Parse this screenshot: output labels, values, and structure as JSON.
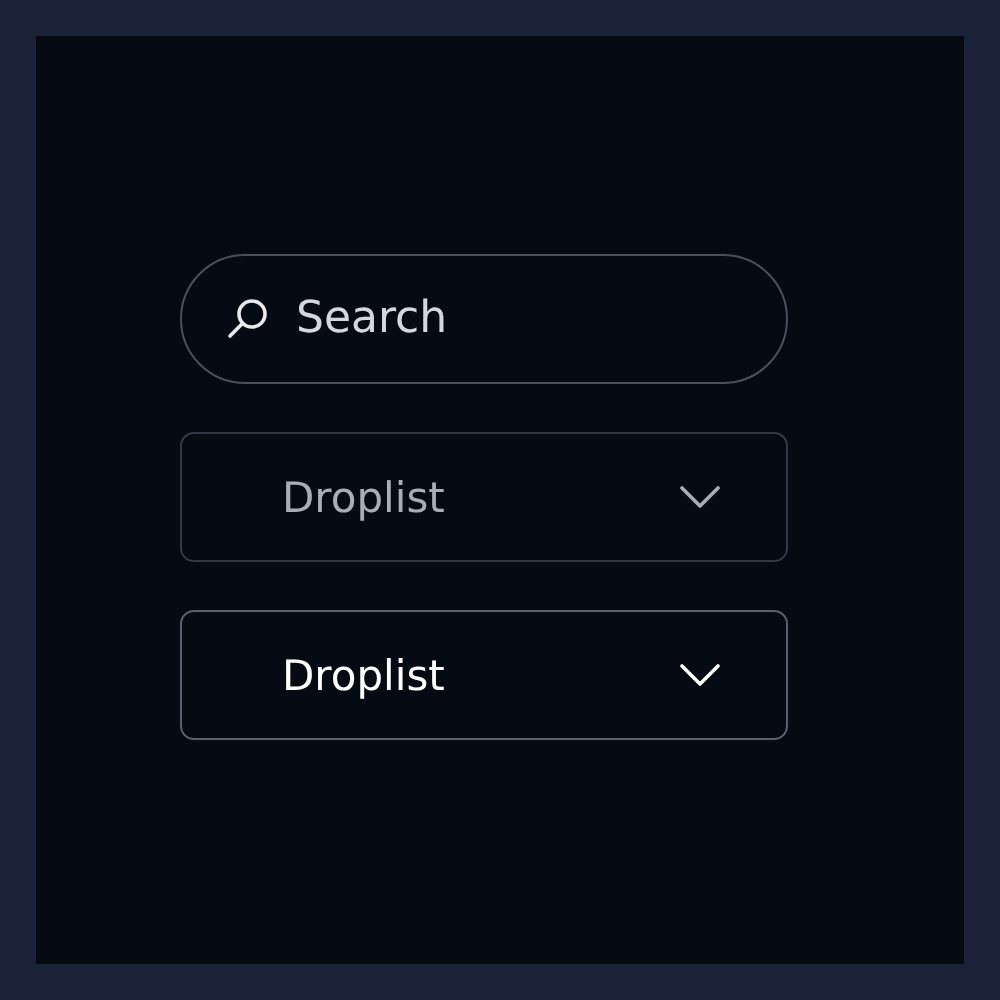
{
  "search": {
    "placeholder": "Search"
  },
  "droplists": [
    {
      "label": "Droplist",
      "active": false
    },
    {
      "label": "Droplist",
      "active": true
    }
  ]
}
